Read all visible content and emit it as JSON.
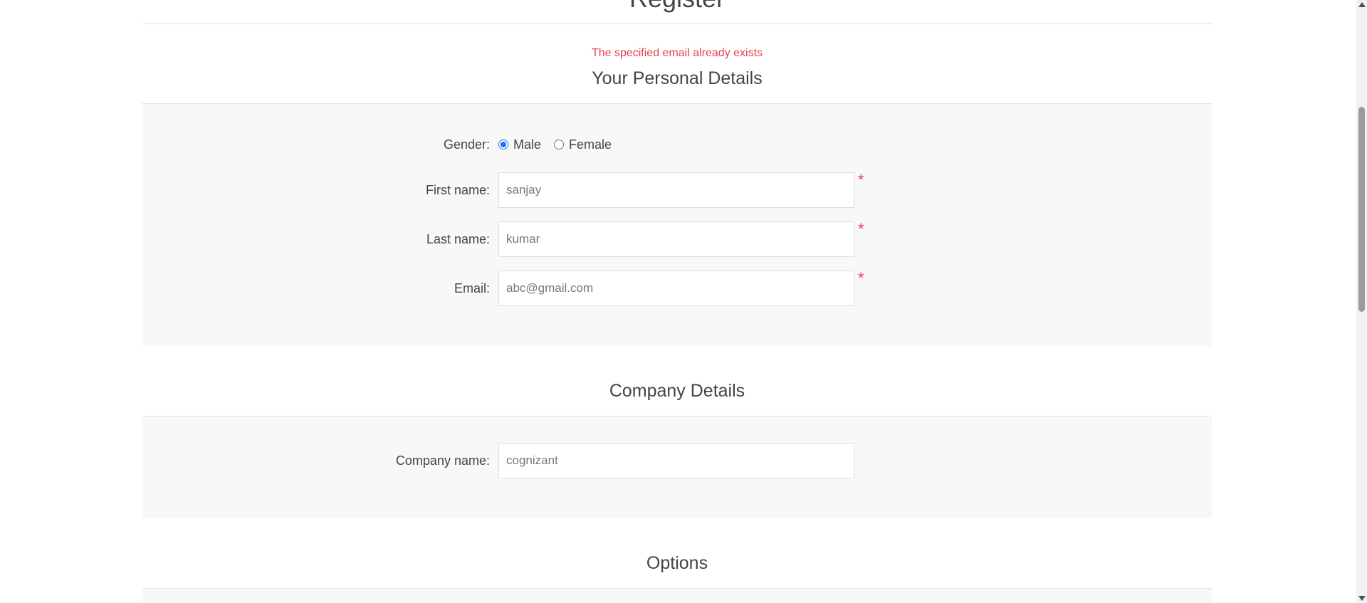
{
  "page": {
    "title": "Register",
    "error_message": "The specified email already exists"
  },
  "personal": {
    "section_title": "Your Personal Details",
    "gender_label": "Gender:",
    "gender_options": [
      {
        "label": "Male",
        "checked": true
      },
      {
        "label": "Female",
        "checked": false
      }
    ],
    "first_name_label": "First name:",
    "first_name_value": "sanjay",
    "last_name_label": "Last name:",
    "last_name_value": "kumar",
    "email_label": "Email:",
    "email_value": "abc@gmail.com",
    "required_mark": "*"
  },
  "company": {
    "section_title": "Company Details",
    "company_name_label": "Company name:",
    "company_name_value": "cognizant"
  },
  "options": {
    "section_title": "Options"
  },
  "colors": {
    "error": "#e4434b",
    "radio_accent": "#1a73e8",
    "section_bg": "#f8f8f8"
  }
}
